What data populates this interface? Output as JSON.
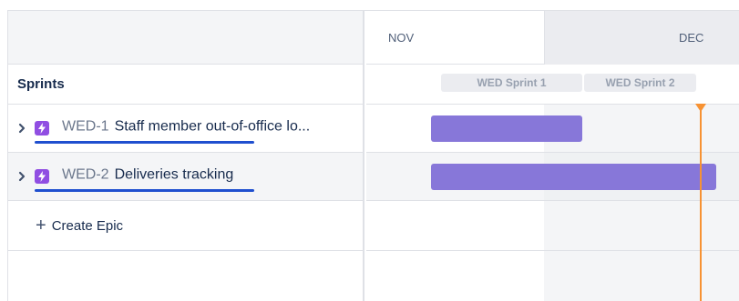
{
  "timeline": {
    "months": [
      {
        "label": "NOV"
      },
      {
        "label": "DEC"
      }
    ],
    "sprints": [
      {
        "label": "WED Sprint 1"
      },
      {
        "label": "WED Sprint 2"
      }
    ]
  },
  "left": {
    "sprints_label": "Sprints",
    "epics": [
      {
        "key": "WED-1",
        "summary": "Staff member out-of-office lo..."
      },
      {
        "key": "WED-2",
        "summary": "Deliveries tracking"
      }
    ],
    "create_label": "Create Epic"
  },
  "colors": {
    "epic_icon": "#904ee2",
    "epic_bar": "#8777d9",
    "today_marker": "#f79233",
    "underline": "#1f4fcf"
  },
  "icons": {
    "expand": "chevron-right-icon",
    "epic": "lightning-bolt-icon",
    "create": "plus-icon"
  }
}
